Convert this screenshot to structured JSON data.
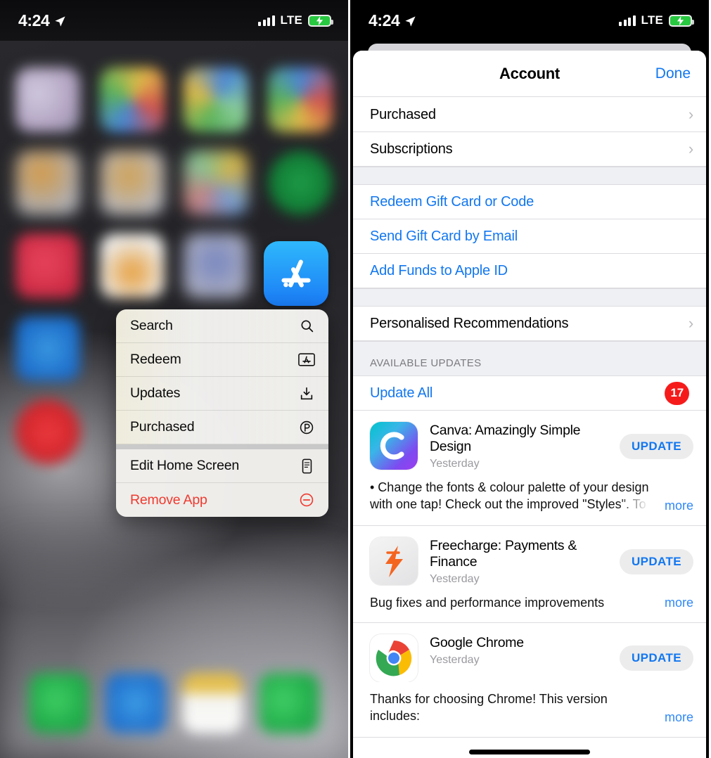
{
  "status_bar": {
    "time": "4:24",
    "carrier": "LTE",
    "location_icon": "location-arrow-icon",
    "signal_icon": "signal-bars-icon",
    "battery_icon": "battery-charging-icon"
  },
  "left_phone": {
    "context_menu": {
      "items": [
        {
          "label": "Search",
          "icon": "magnifier-icon",
          "style": "normal"
        },
        {
          "label": "Redeem",
          "icon": "gift-card-icon",
          "style": "normal"
        },
        {
          "label": "Updates",
          "icon": "download-tray-icon",
          "style": "normal"
        },
        {
          "label": "Purchased",
          "icon": "circled-p-icon",
          "style": "normal"
        },
        {
          "label": "Edit Home Screen",
          "icon": "phone-edit-icon",
          "style": "normal"
        },
        {
          "label": "Remove App",
          "icon": "minus-circle-icon",
          "style": "destructive"
        }
      ]
    },
    "focused_app": {
      "name": "App Store",
      "icon": "app-store-icon",
      "color": "#1a7bf5"
    }
  },
  "right_phone": {
    "header": {
      "title": "Account",
      "done_label": "Done",
      "done_color": "#1277f0"
    },
    "account_rows": [
      {
        "label": "Purchased",
        "accessory": "chevron-right-icon"
      },
      {
        "label": "Subscriptions",
        "accessory": "chevron-right-icon"
      }
    ],
    "gift_links": [
      {
        "label": "Redeem Gift Card or Code"
      },
      {
        "label": "Send Gift Card by Email"
      },
      {
        "label": "Add Funds to Apple ID"
      }
    ],
    "recommendations_row": {
      "label": "Personalised Recommendations",
      "accessory": "chevron-right-icon"
    },
    "updates_section": {
      "header": "AVAILABLE UPDATES",
      "update_all_label": "Update All",
      "update_all_badge": "17",
      "badge_color": "#f61b1b",
      "apps": [
        {
          "name": "Canva: Amazingly Simple Design",
          "date": "Yesterday",
          "button": "UPDATE",
          "description": "• Change the fonts & colour palette of your design with one tap! Check out the improved \"Styles\". To access in the e",
          "more_label": "more",
          "icon": "canva-icon",
          "truncated": true
        },
        {
          "name": "Freecharge: Payments & Finance",
          "date": "Yesterday",
          "button": "UPDATE",
          "description": "Bug fixes and performance improvements",
          "more_label": "more",
          "icon": "freecharge-icon",
          "truncated": false
        },
        {
          "name": "Google Chrome",
          "date": "Yesterday",
          "button": "UPDATE",
          "description": "Thanks for choosing Chrome! This version includes:\n• Stability and performance improvements.",
          "more_label": "more",
          "icon": "chrome-icon",
          "truncated": false
        }
      ]
    }
  }
}
